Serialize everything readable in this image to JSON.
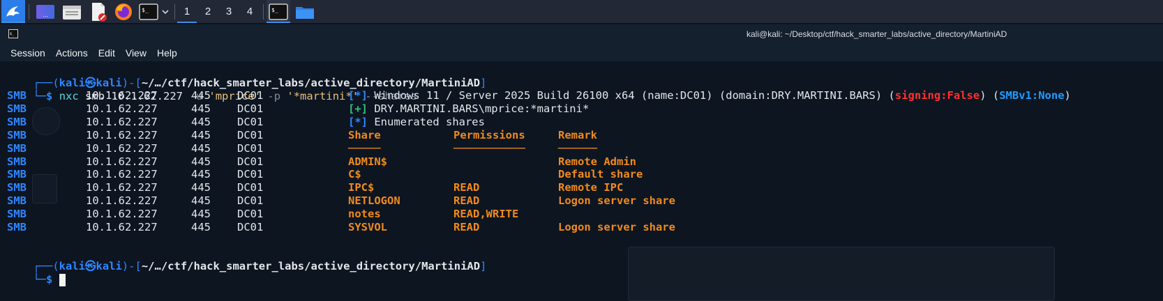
{
  "taskbar": {
    "workspaces": [
      "1",
      "2",
      "3",
      "4"
    ],
    "active_workspace": "1"
  },
  "window": {
    "title": "kali@kali: ~/Desktop/ctf/hack_smarter_labs/active_directory/MartiniAD"
  },
  "menu": [
    "Session",
    "Actions",
    "Edit",
    "View",
    "Help"
  ],
  "prompt": {
    "user": "kali",
    "at": "㉿",
    "host": "kali",
    "path": "~/…/ctf/hack_smarter_labs/active_directory/MartiniAD",
    "symbol": "$"
  },
  "command": {
    "bin": "nxc",
    "args": "smb 10.1.62.227",
    "flag_u": "-u",
    "user_arg": "'mprice'",
    "flag_p": "-p",
    "pass_arg": "'*martini*'",
    "extra": "--shares"
  },
  "output": {
    "proto": "SMB",
    "ip": "10.1.62.227",
    "port": "445",
    "host": "DC01",
    "info_line": {
      "marker": "[*]",
      "text": "Windows 11 / Server 2025 Build 26100 x64 (name:DC01) (domain:DRY.MARTINI.BARS) (",
      "signing": "signing:False",
      "mid": ") (",
      "smbv1": "SMBv1:None",
      "end": ")"
    },
    "auth_line": {
      "marker": "[+]",
      "text": "DRY.MARTINI.BARS\\mprice:*martini*"
    },
    "enum_line": {
      "marker": "[*]",
      "text": "Enumerated shares"
    },
    "headers": {
      "share": "Share",
      "permissions": "Permissions",
      "remark": "Remark"
    },
    "underlines": {
      "share": "─────",
      "permissions": "───────────",
      "remark": "──────"
    },
    "shares": [
      {
        "name": "ADMIN$",
        "perm": "",
        "remark": "Remote Admin"
      },
      {
        "name": "C$",
        "perm": "",
        "remark": "Default share"
      },
      {
        "name": "IPC$",
        "perm": "READ",
        "remark": "Remote IPC"
      },
      {
        "name": "NETLOGON",
        "perm": "READ",
        "remark": "Logon server share"
      },
      {
        "name": "notes",
        "perm": "READ,WRITE",
        "remark": ""
      },
      {
        "name": "SYSVOL",
        "perm": "READ",
        "remark": "Logon server share"
      }
    ]
  },
  "colors": {
    "prompt_blue": "#2f86ff",
    "share_orange": "#f08a1c",
    "signing_red": "#ff3030",
    "smbv1_cyan": "#1e9cff",
    "active_indicator": "#3f8fe8"
  }
}
